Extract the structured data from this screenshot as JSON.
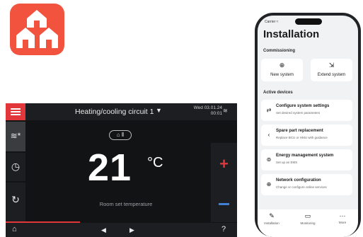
{
  "app_icon": {
    "icon": "houses-icon",
    "color": "#f2533e"
  },
  "controller": {
    "title": "Heating/cooling circuit 1",
    "date": "Wed 03.01.24",
    "time": "00:01",
    "mode_indicator": "⌂ ⫴",
    "temperature": "21",
    "unit": "°C",
    "temperature_label": "Room set temperature",
    "accent_red": "#e2373a",
    "accent_blue": "#3f7fd6"
  },
  "phone": {
    "status": "Carrier ≈",
    "title": "Installation",
    "commissioning_label": "Commissioning",
    "tiles": [
      {
        "icon": "plus-circle-icon",
        "label": "New system"
      },
      {
        "icon": "extend-icon",
        "label": "Extend system"
      }
    ],
    "active_devices_label": "Active devices",
    "cards": [
      {
        "icon": "sliders-icon",
        "title": "Configure system settings",
        "subtitle": "Set desired system parameters"
      },
      {
        "icon": "chevron-left-icon",
        "title": "Spare part replacement",
        "subtitle": "Replace BCU or HMU with guidance"
      },
      {
        "icon": "energy-icon",
        "title": "Energy management system",
        "subtitle": "Set up an EMS"
      },
      {
        "icon": "globe-icon",
        "title": "Network configuration",
        "subtitle": "Change or configure online services"
      }
    ],
    "tabs": [
      {
        "icon": "wrench-icon",
        "label": "Installation"
      },
      {
        "icon": "monitor-icon",
        "label": "Monitoring"
      },
      {
        "icon": "more-icon",
        "label": "More"
      }
    ]
  }
}
